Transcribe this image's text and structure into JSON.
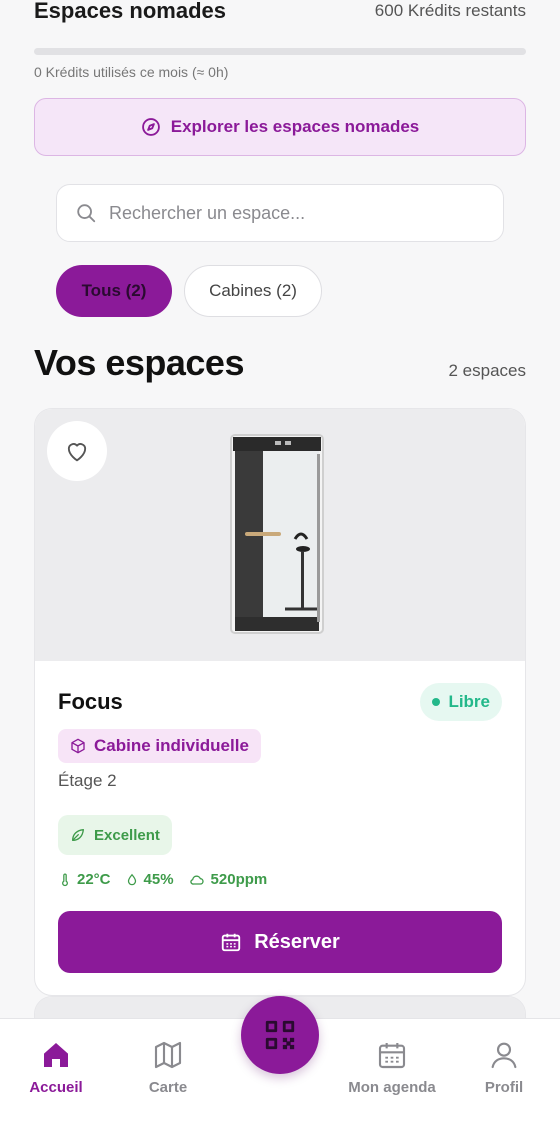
{
  "nomad": {
    "title": "Espaces nomades",
    "credits_remaining": "600 Krédits restants",
    "usage_fraction": 0,
    "used_text": "0 Krédits utilisés ce mois (≈ 0h)",
    "explore_label": "Explorer les espaces nomades"
  },
  "search": {
    "placeholder": "Rechercher un espace..."
  },
  "filters": [
    {
      "label": "Tous (2)",
      "active": true
    },
    {
      "label": "Cabines (2)",
      "active": false
    }
  ],
  "section": {
    "title": "Vos espaces",
    "count": "2 espaces"
  },
  "spaces": [
    {
      "name": "Focus",
      "status": "Libre",
      "type": "Cabine individuelle",
      "floor": "Étage 2",
      "air_quality": "Excellent",
      "temperature": "22°C",
      "humidity": "45%",
      "co2": "520ppm",
      "reserve_label": "Réserver"
    }
  ],
  "tabbar": {
    "home": "Accueil",
    "map": "Carte",
    "agenda": "Mon agenda",
    "profile": "Profil"
  },
  "colors": {
    "accent": "#8b1a99",
    "status_free": "#23b88a",
    "quality": "#3e9b4a"
  }
}
